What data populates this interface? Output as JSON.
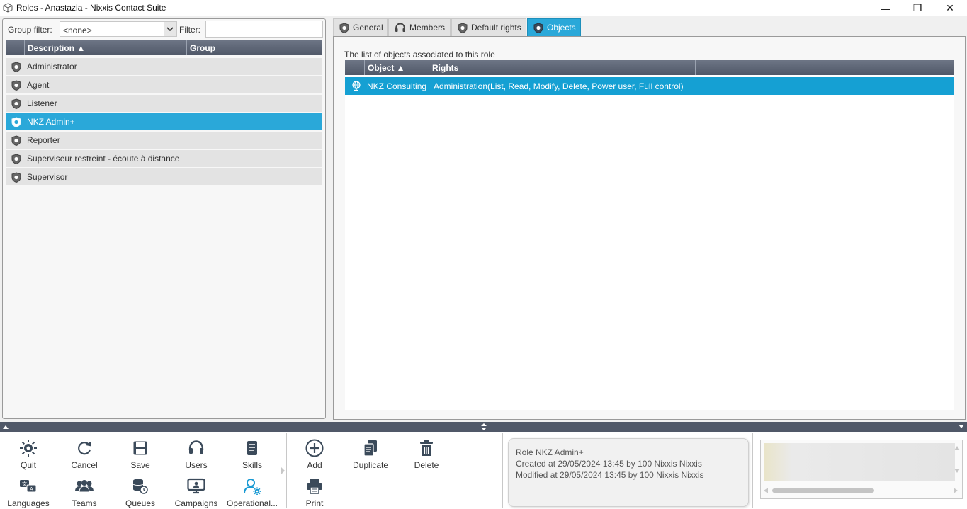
{
  "window": {
    "title": "Roles - Anastazia - Nixxis Contact Suite",
    "minimize_glyph": "—",
    "restore_glyph": "❐",
    "close_glyph": "✕"
  },
  "left": {
    "group_filter_label": "Group filter:",
    "group_filter_value": "<none>",
    "filter_label": "Filter:",
    "filter_value": "",
    "columns": {
      "description": "Description ▲",
      "group": "Group"
    },
    "roles": [
      {
        "label": "Administrator",
        "selected": false
      },
      {
        "label": "Agent",
        "selected": false
      },
      {
        "label": "Listener",
        "selected": false
      },
      {
        "label": "NKZ Admin+",
        "selected": true
      },
      {
        "label": "Reporter",
        "selected": false
      },
      {
        "label": "Superviseur restreint - écoute à distance",
        "selected": false
      },
      {
        "label": "Supervisor",
        "selected": false
      }
    ]
  },
  "tabs": [
    {
      "label": "General",
      "icon": "shield-icon"
    },
    {
      "label": "Members",
      "icon": "headset-icon"
    },
    {
      "label": "Default rights",
      "icon": "shield-icon"
    },
    {
      "label": "Objects",
      "icon": "shield-icon",
      "active": true
    }
  ],
  "objects": {
    "caption": "The list of objects associated to this role",
    "columns": {
      "object": "Object ▲",
      "rights": "Rights"
    },
    "rows": [
      {
        "object": "NKZ Consulting",
        "rights": "Administration(List, Read, Modify, Delete, Power user, Full control)"
      }
    ]
  },
  "toolbar": {
    "quit": "Quit",
    "cancel": "Cancel",
    "save": "Save",
    "users": "Users",
    "skills": "Skills",
    "languages": "Languages",
    "teams": "Teams",
    "queues": "Queues",
    "campaigns": "Campaigns",
    "operational": "Operational...",
    "add": "Add",
    "duplicate": "Duplicate",
    "delete": "Delete",
    "print": "Print"
  },
  "info": {
    "line1": "Role NKZ Admin+",
    "line2": "Created at 29/05/2024 13:45 by 100 Nixxis Nixxis",
    "line3": "Modified at 29/05/2024 13:45 by 100 Nixxis Nixxis"
  },
  "colors": {
    "accent": "#2aa8d9",
    "header": "#505868",
    "row": "#e3e3e3"
  }
}
